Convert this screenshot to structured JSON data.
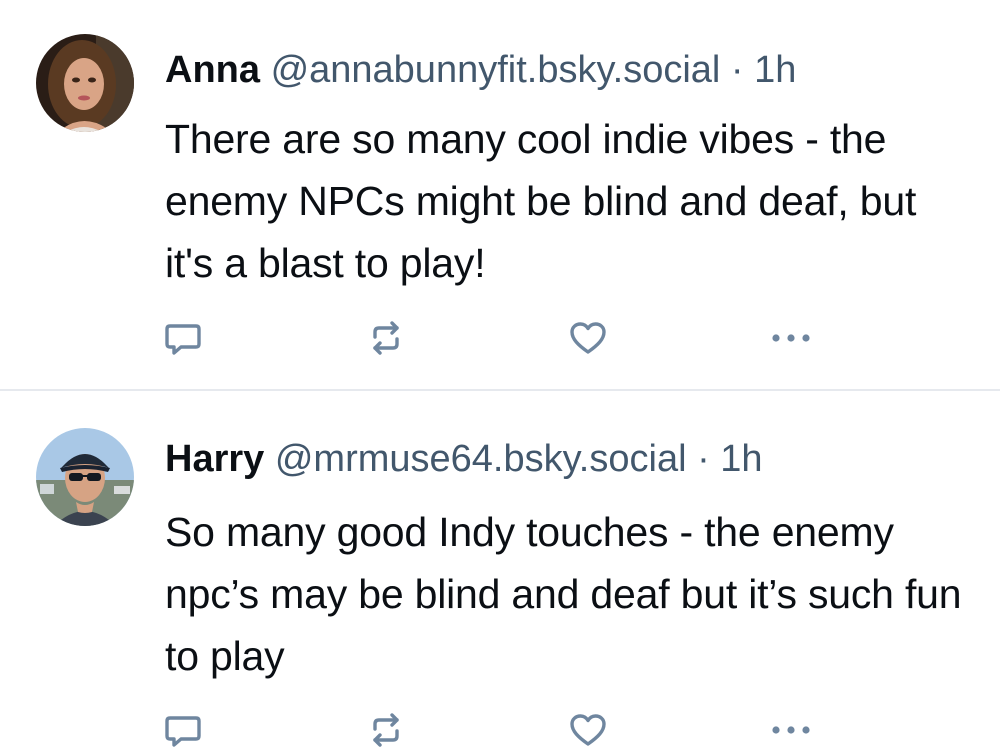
{
  "colors": {
    "text": "#0b0f14",
    "secondary": "#42576c",
    "icon": "#6f869f",
    "divider": "#e6e9ee"
  },
  "posts": [
    {
      "display_name": "Anna",
      "handle": "@annabunnyfit.bsky.social",
      "separator": "·",
      "time": "1h",
      "text": "There are so many cool indie vibes - the enemy NPCs might be blind and deaf, but it's a blast to play!",
      "avatar_icon": "avatar-photo-woman",
      "actions": [
        "reply-icon",
        "repost-icon",
        "like-heart-icon",
        "more-options-icon"
      ]
    },
    {
      "display_name": "Harry",
      "handle": "@mrmuse64.bsky.social",
      "separator": "·",
      "time": "1h",
      "text": "So many good Indy touches - the enemy npc’s may be blind and deaf but it’s such fun to play",
      "avatar_icon": "avatar-photo-man-cap-sunglasses",
      "actions": [
        "reply-icon",
        "repost-icon",
        "like-heart-icon",
        "more-options-icon"
      ]
    }
  ]
}
